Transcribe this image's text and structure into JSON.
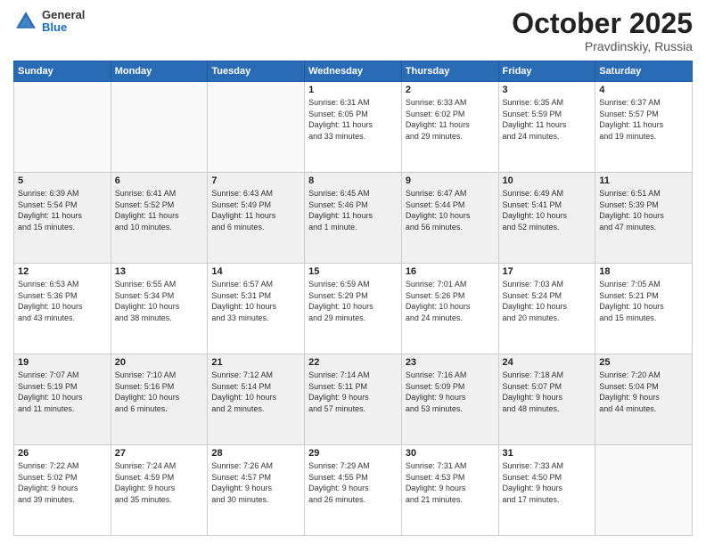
{
  "header": {
    "logo": {
      "general": "General",
      "blue": "Blue"
    },
    "title": "October 2025",
    "location": "Pravdinskiy, Russia"
  },
  "weekdays": [
    "Sunday",
    "Monday",
    "Tuesday",
    "Wednesday",
    "Thursday",
    "Friday",
    "Saturday"
  ],
  "weeks": [
    [
      {
        "day": "",
        "info": "",
        "empty": true
      },
      {
        "day": "",
        "info": "",
        "empty": true
      },
      {
        "day": "",
        "info": "",
        "empty": true
      },
      {
        "day": "1",
        "info": "Sunrise: 6:31 AM\nSunset: 6:05 PM\nDaylight: 11 hours\nand 33 minutes."
      },
      {
        "day": "2",
        "info": "Sunrise: 6:33 AM\nSunset: 6:02 PM\nDaylight: 11 hours\nand 29 minutes."
      },
      {
        "day": "3",
        "info": "Sunrise: 6:35 AM\nSunset: 5:59 PM\nDaylight: 11 hours\nand 24 minutes."
      },
      {
        "day": "4",
        "info": "Sunrise: 6:37 AM\nSunset: 5:57 PM\nDaylight: 11 hours\nand 19 minutes."
      }
    ],
    [
      {
        "day": "5",
        "info": "Sunrise: 6:39 AM\nSunset: 5:54 PM\nDaylight: 11 hours\nand 15 minutes.",
        "shaded": true
      },
      {
        "day": "6",
        "info": "Sunrise: 6:41 AM\nSunset: 5:52 PM\nDaylight: 11 hours\nand 10 minutes.",
        "shaded": true
      },
      {
        "day": "7",
        "info": "Sunrise: 6:43 AM\nSunset: 5:49 PM\nDaylight: 11 hours\nand 6 minutes.",
        "shaded": true
      },
      {
        "day": "8",
        "info": "Sunrise: 6:45 AM\nSunset: 5:46 PM\nDaylight: 11 hours\nand 1 minute.",
        "shaded": true
      },
      {
        "day": "9",
        "info": "Sunrise: 6:47 AM\nSunset: 5:44 PM\nDaylight: 10 hours\nand 56 minutes.",
        "shaded": true
      },
      {
        "day": "10",
        "info": "Sunrise: 6:49 AM\nSunset: 5:41 PM\nDaylight: 10 hours\nand 52 minutes.",
        "shaded": true
      },
      {
        "day": "11",
        "info": "Sunrise: 6:51 AM\nSunset: 5:39 PM\nDaylight: 10 hours\nand 47 minutes.",
        "shaded": true
      }
    ],
    [
      {
        "day": "12",
        "info": "Sunrise: 6:53 AM\nSunset: 5:36 PM\nDaylight: 10 hours\nand 43 minutes."
      },
      {
        "day": "13",
        "info": "Sunrise: 6:55 AM\nSunset: 5:34 PM\nDaylight: 10 hours\nand 38 minutes."
      },
      {
        "day": "14",
        "info": "Sunrise: 6:57 AM\nSunset: 5:31 PM\nDaylight: 10 hours\nand 33 minutes."
      },
      {
        "day": "15",
        "info": "Sunrise: 6:59 AM\nSunset: 5:29 PM\nDaylight: 10 hours\nand 29 minutes."
      },
      {
        "day": "16",
        "info": "Sunrise: 7:01 AM\nSunset: 5:26 PM\nDaylight: 10 hours\nand 24 minutes."
      },
      {
        "day": "17",
        "info": "Sunrise: 7:03 AM\nSunset: 5:24 PM\nDaylight: 10 hours\nand 20 minutes."
      },
      {
        "day": "18",
        "info": "Sunrise: 7:05 AM\nSunset: 5:21 PM\nDaylight: 10 hours\nand 15 minutes."
      }
    ],
    [
      {
        "day": "19",
        "info": "Sunrise: 7:07 AM\nSunset: 5:19 PM\nDaylight: 10 hours\nand 11 minutes.",
        "shaded": true
      },
      {
        "day": "20",
        "info": "Sunrise: 7:10 AM\nSunset: 5:16 PM\nDaylight: 10 hours\nand 6 minutes.",
        "shaded": true
      },
      {
        "day": "21",
        "info": "Sunrise: 7:12 AM\nSunset: 5:14 PM\nDaylight: 10 hours\nand 2 minutes.",
        "shaded": true
      },
      {
        "day": "22",
        "info": "Sunrise: 7:14 AM\nSunset: 5:11 PM\nDaylight: 9 hours\nand 57 minutes.",
        "shaded": true
      },
      {
        "day": "23",
        "info": "Sunrise: 7:16 AM\nSunset: 5:09 PM\nDaylight: 9 hours\nand 53 minutes.",
        "shaded": true
      },
      {
        "day": "24",
        "info": "Sunrise: 7:18 AM\nSunset: 5:07 PM\nDaylight: 9 hours\nand 48 minutes.",
        "shaded": true
      },
      {
        "day": "25",
        "info": "Sunrise: 7:20 AM\nSunset: 5:04 PM\nDaylight: 9 hours\nand 44 minutes.",
        "shaded": true
      }
    ],
    [
      {
        "day": "26",
        "info": "Sunrise: 7:22 AM\nSunset: 5:02 PM\nDaylight: 9 hours\nand 39 minutes."
      },
      {
        "day": "27",
        "info": "Sunrise: 7:24 AM\nSunset: 4:59 PM\nDaylight: 9 hours\nand 35 minutes."
      },
      {
        "day": "28",
        "info": "Sunrise: 7:26 AM\nSunset: 4:57 PM\nDaylight: 9 hours\nand 30 minutes."
      },
      {
        "day": "29",
        "info": "Sunrise: 7:29 AM\nSunset: 4:55 PM\nDaylight: 9 hours\nand 26 minutes."
      },
      {
        "day": "30",
        "info": "Sunrise: 7:31 AM\nSunset: 4:53 PM\nDaylight: 9 hours\nand 21 minutes."
      },
      {
        "day": "31",
        "info": "Sunrise: 7:33 AM\nSunset: 4:50 PM\nDaylight: 9 hours\nand 17 minutes."
      },
      {
        "day": "",
        "info": "",
        "empty": true
      }
    ]
  ]
}
